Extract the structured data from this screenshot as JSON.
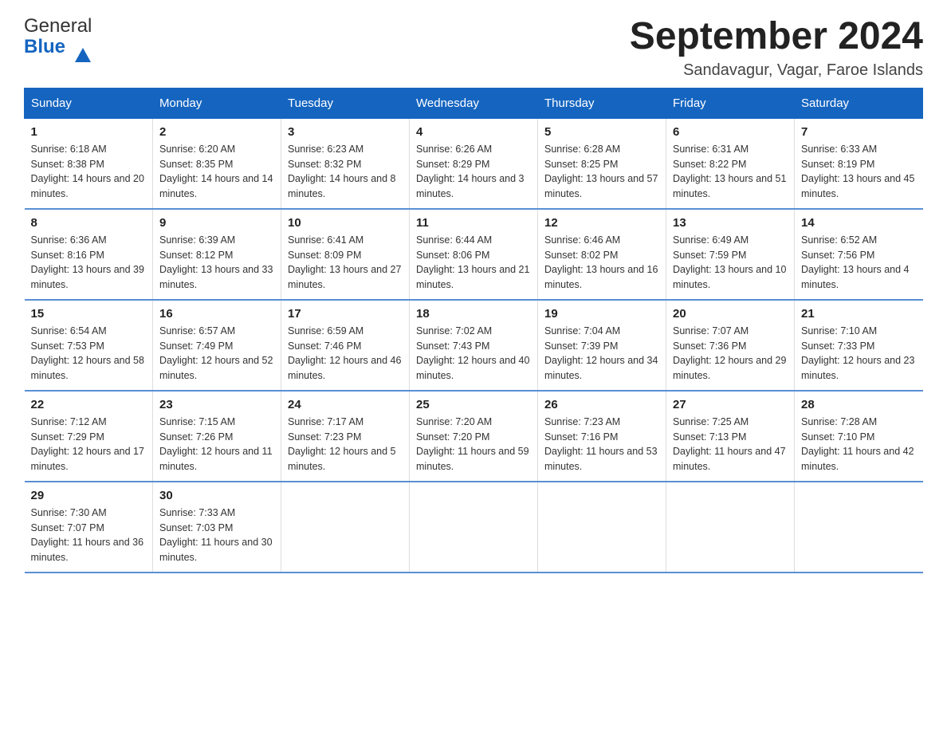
{
  "logo": {
    "general": "General",
    "blue": "Blue"
  },
  "title": "September 2024",
  "subtitle": "Sandavagur, Vagar, Faroe Islands",
  "days_of_week": [
    "Sunday",
    "Monday",
    "Tuesday",
    "Wednesday",
    "Thursday",
    "Friday",
    "Saturday"
  ],
  "weeks": [
    [
      {
        "day": "1",
        "sunrise": "6:18 AM",
        "sunset": "8:38 PM",
        "daylight": "14 hours and 20 minutes."
      },
      {
        "day": "2",
        "sunrise": "6:20 AM",
        "sunset": "8:35 PM",
        "daylight": "14 hours and 14 minutes."
      },
      {
        "day": "3",
        "sunrise": "6:23 AM",
        "sunset": "8:32 PM",
        "daylight": "14 hours and 8 minutes."
      },
      {
        "day": "4",
        "sunrise": "6:26 AM",
        "sunset": "8:29 PM",
        "daylight": "14 hours and 3 minutes."
      },
      {
        "day": "5",
        "sunrise": "6:28 AM",
        "sunset": "8:25 PM",
        "daylight": "13 hours and 57 minutes."
      },
      {
        "day": "6",
        "sunrise": "6:31 AM",
        "sunset": "8:22 PM",
        "daylight": "13 hours and 51 minutes."
      },
      {
        "day": "7",
        "sunrise": "6:33 AM",
        "sunset": "8:19 PM",
        "daylight": "13 hours and 45 minutes."
      }
    ],
    [
      {
        "day": "8",
        "sunrise": "6:36 AM",
        "sunset": "8:16 PM",
        "daylight": "13 hours and 39 minutes."
      },
      {
        "day": "9",
        "sunrise": "6:39 AM",
        "sunset": "8:12 PM",
        "daylight": "13 hours and 33 minutes."
      },
      {
        "day": "10",
        "sunrise": "6:41 AM",
        "sunset": "8:09 PM",
        "daylight": "13 hours and 27 minutes."
      },
      {
        "day": "11",
        "sunrise": "6:44 AM",
        "sunset": "8:06 PM",
        "daylight": "13 hours and 21 minutes."
      },
      {
        "day": "12",
        "sunrise": "6:46 AM",
        "sunset": "8:02 PM",
        "daylight": "13 hours and 16 minutes."
      },
      {
        "day": "13",
        "sunrise": "6:49 AM",
        "sunset": "7:59 PM",
        "daylight": "13 hours and 10 minutes."
      },
      {
        "day": "14",
        "sunrise": "6:52 AM",
        "sunset": "7:56 PM",
        "daylight": "13 hours and 4 minutes."
      }
    ],
    [
      {
        "day": "15",
        "sunrise": "6:54 AM",
        "sunset": "7:53 PM",
        "daylight": "12 hours and 58 minutes."
      },
      {
        "day": "16",
        "sunrise": "6:57 AM",
        "sunset": "7:49 PM",
        "daylight": "12 hours and 52 minutes."
      },
      {
        "day": "17",
        "sunrise": "6:59 AM",
        "sunset": "7:46 PM",
        "daylight": "12 hours and 46 minutes."
      },
      {
        "day": "18",
        "sunrise": "7:02 AM",
        "sunset": "7:43 PM",
        "daylight": "12 hours and 40 minutes."
      },
      {
        "day": "19",
        "sunrise": "7:04 AM",
        "sunset": "7:39 PM",
        "daylight": "12 hours and 34 minutes."
      },
      {
        "day": "20",
        "sunrise": "7:07 AM",
        "sunset": "7:36 PM",
        "daylight": "12 hours and 29 minutes."
      },
      {
        "day": "21",
        "sunrise": "7:10 AM",
        "sunset": "7:33 PM",
        "daylight": "12 hours and 23 minutes."
      }
    ],
    [
      {
        "day": "22",
        "sunrise": "7:12 AM",
        "sunset": "7:29 PM",
        "daylight": "12 hours and 17 minutes."
      },
      {
        "day": "23",
        "sunrise": "7:15 AM",
        "sunset": "7:26 PM",
        "daylight": "12 hours and 11 minutes."
      },
      {
        "day": "24",
        "sunrise": "7:17 AM",
        "sunset": "7:23 PM",
        "daylight": "12 hours and 5 minutes."
      },
      {
        "day": "25",
        "sunrise": "7:20 AM",
        "sunset": "7:20 PM",
        "daylight": "11 hours and 59 minutes."
      },
      {
        "day": "26",
        "sunrise": "7:23 AM",
        "sunset": "7:16 PM",
        "daylight": "11 hours and 53 minutes."
      },
      {
        "day": "27",
        "sunrise": "7:25 AM",
        "sunset": "7:13 PM",
        "daylight": "11 hours and 47 minutes."
      },
      {
        "day": "28",
        "sunrise": "7:28 AM",
        "sunset": "7:10 PM",
        "daylight": "11 hours and 42 minutes."
      }
    ],
    [
      {
        "day": "29",
        "sunrise": "7:30 AM",
        "sunset": "7:07 PM",
        "daylight": "11 hours and 36 minutes."
      },
      {
        "day": "30",
        "sunrise": "7:33 AM",
        "sunset": "7:03 PM",
        "daylight": "11 hours and 30 minutes."
      },
      null,
      null,
      null,
      null,
      null
    ]
  ]
}
